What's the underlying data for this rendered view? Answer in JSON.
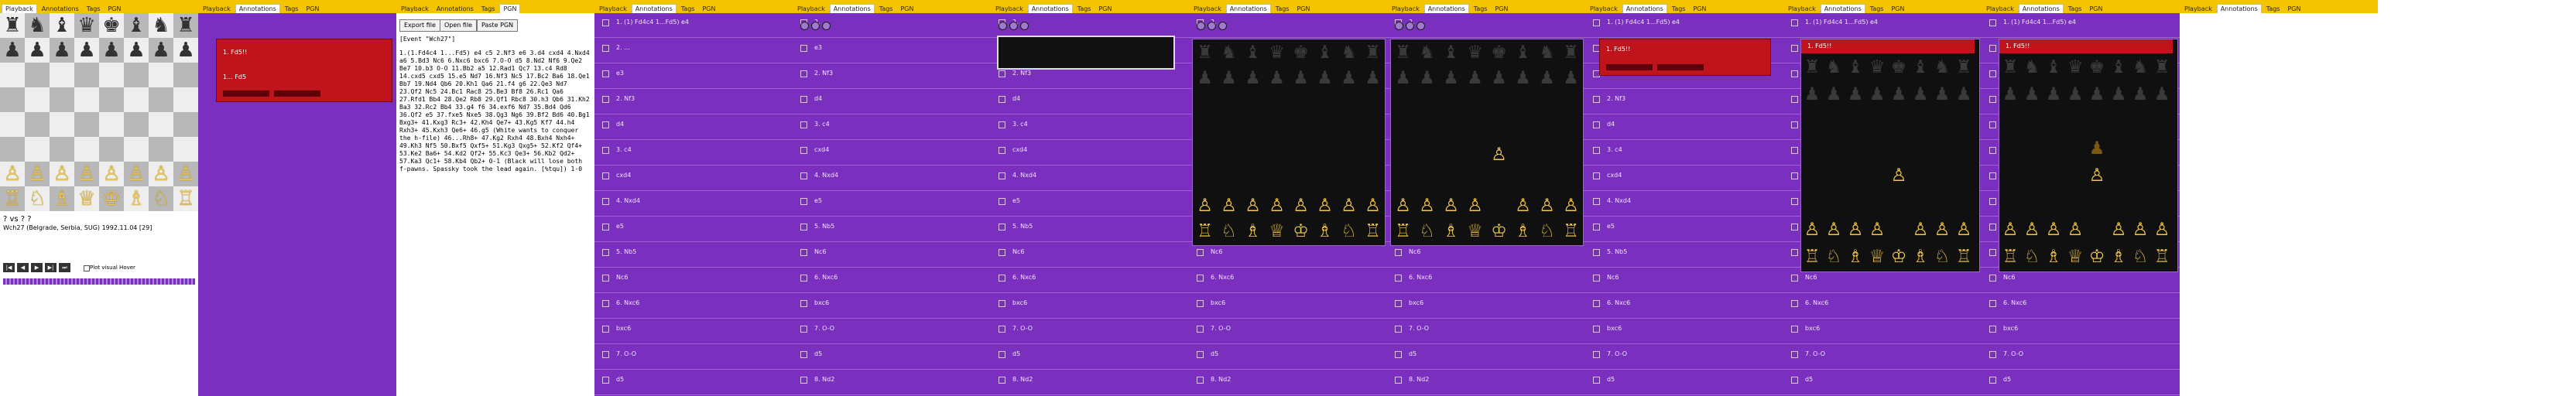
{
  "tabs": [
    "Playback",
    "Annotations",
    "Tags",
    "PGN"
  ],
  "game": {
    "players": "? vs ? ?",
    "event": "Wch27 (Belgrade, Serbia, SUG) 1992.11.04 [29]",
    "checkbox_label": "Plot visual Hover"
  },
  "moves": [
    "1. (1) Fd4c4 1...Fd5) e4",
    "2. ...",
    "e3",
    "2. Nf3",
    "d4",
    "3. c4",
    "cxd4",
    "4. Nxd4",
    "e5",
    "5. Nb5",
    "Nc6",
    "6. Nxc6",
    "bxc6",
    "7. O-O",
    "d5",
    "8. Nd2"
  ],
  "annotation": {
    "lines": [
      "1. Fd5!!",
      "1... Fd5"
    ]
  },
  "pgn": {
    "buttons": [
      "Export file",
      "Open file",
      "Paste PGN"
    ],
    "header": "[Event \"Wch27\"]",
    "body": "1.(1.Fd4c4 1...Fd5) e4 c5 2.Nf3 e6 3.d4 cxd4 4.Nxd4 a6 5.Bd3 Nc6 6.Nxc6 bxc6 7.O-O d5 8.Nd2 Nf6 9.Qe2 Be7 10.b3 O-O 11.Bb2 a5 12.Rad1 Qc7 13.c4 Rd8 14.cxd5 cxd5 15.e5 Nd7 16.Nf3 Nc5 17.Bc2 Ba6 18.Qe1 Bb7 19.Nd4 Qb6 20.Kh1 Qa6 21.f4 g6 22.Qe3 Nd7 23.Qf2 Nc5 24.Bc1 Rac8 25.Be3 Bf8 26.Rc1 Qa6 27.Rfd1 Bb4 28.Qe2 Rb8 29.Qf1 Rbc8 30.h3 Qb6 31.Kh2 Ba3 32.Rc2 Bb4 33.g4 f6 34.exf6 Nd7 35.Bd4 Qd6 36.Qf2 e5 37.fxe5 Nxe5 38.Qg3 Ng6 39.Bf2 Bd6 40.Bg1 Bxg3+ 41.Kxg3 Rc3+ 42.Kh4 Qe7+ 43.Kg5 Kf7 44.h4 Rxh3+ 45.Kxh3 Qe6+ 46.g5 (White wants to conquer the h-file) 46...Rh8+ 47.Kg2 Rxh4 48.Bxh4 Nxh4+ 49.Kh3 Nf5 50.Bxf5 Qxf5+ 51.Kg3 Qxg5+ 52.Kf2 Qf4+ 53.Ke2 Ba6+ 54.Kd2 Qf2+ 55.Kc3 Qe3+ 56.Kb2 Qd2+ 57.Ka3 Qc1+ 58.Kb4 Qb2+ 0-1 (Black will lose both f-pawns. Spassky took the lead again. [%tqu]) 1-0"
  },
  "colors": {
    "tabbar": "#f5c400",
    "panel": "#7b2fbe",
    "annotation": "#c0141c"
  }
}
